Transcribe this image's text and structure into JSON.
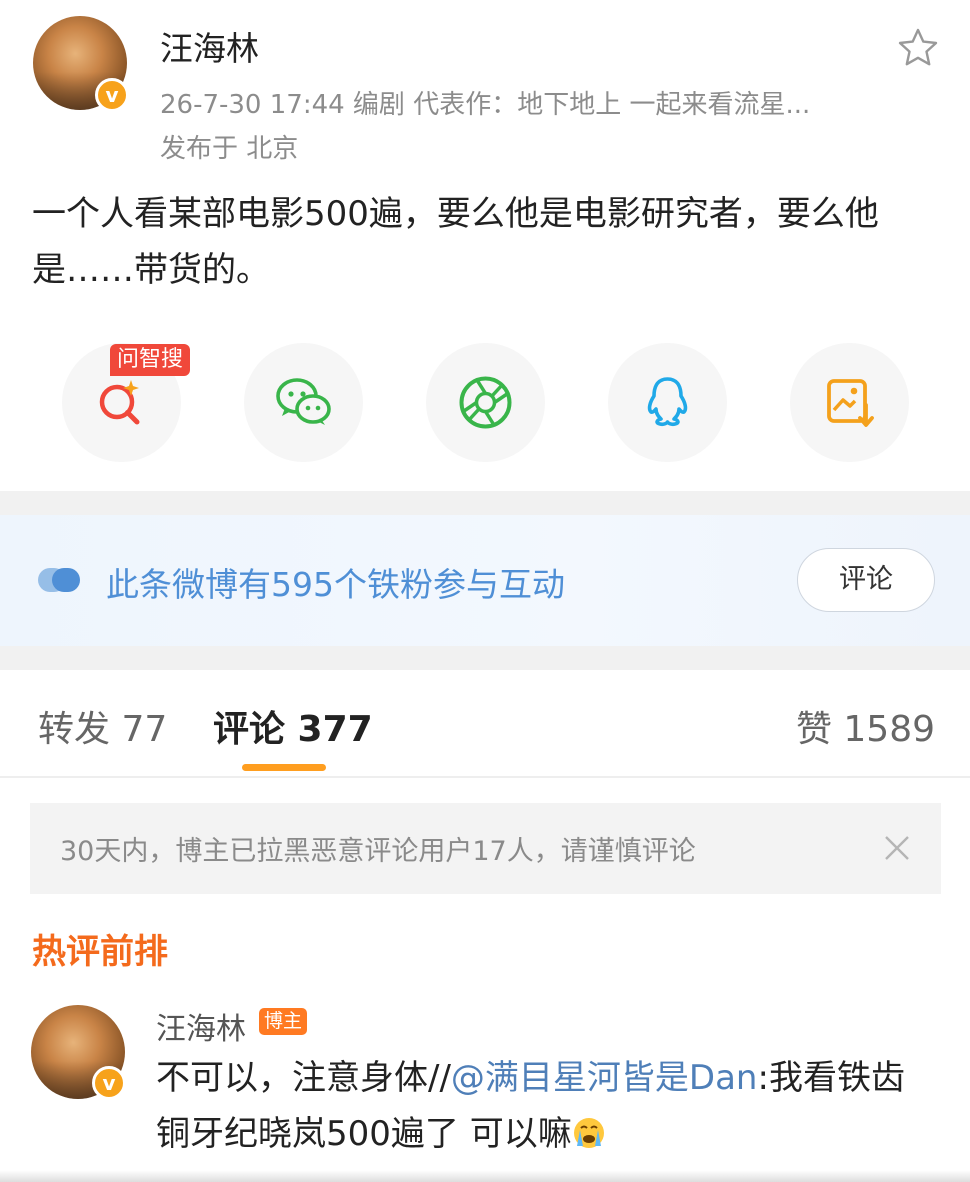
{
  "post": {
    "author_name": "汪海林",
    "meta": "26-7-30 17:44  编剧 代表作：地下地上 一起来看流星...",
    "location": "发布于 北京",
    "text": "一个人看某部电影500遍，要么他是电影研究者，要么他是……带货的。"
  },
  "share": {
    "wenzhisou_tag": "问智搜",
    "icons": [
      "magnifier-sparkle-icon",
      "wechat-icon",
      "moments-icon",
      "qq-icon",
      "save-image-icon"
    ]
  },
  "fans_banner": {
    "text": "此条微博有595个铁粉参与互动",
    "button_label": "评论"
  },
  "tabs": {
    "reposts": "转发 77",
    "comments": "评论 377",
    "likes": "赞 1589"
  },
  "notice": {
    "text": "30天内，博主已拉黑恶意评论用户17人，请谨慎评论"
  },
  "hot_heading": "热评前排",
  "comment": {
    "author": "汪海林",
    "badge": "博主",
    "prefix": "不可以，注意身体//",
    "mention": "@满目星河皆是Dan",
    "rest": ":我看铁齿铜牙纪晓岚500遍了 可以嘛"
  },
  "colors": {
    "accent_orange": "#ff9e1f",
    "link_blue": "#4f7fb8",
    "vip_badge": "#f7a21b",
    "tag_red": "#f0483a"
  }
}
